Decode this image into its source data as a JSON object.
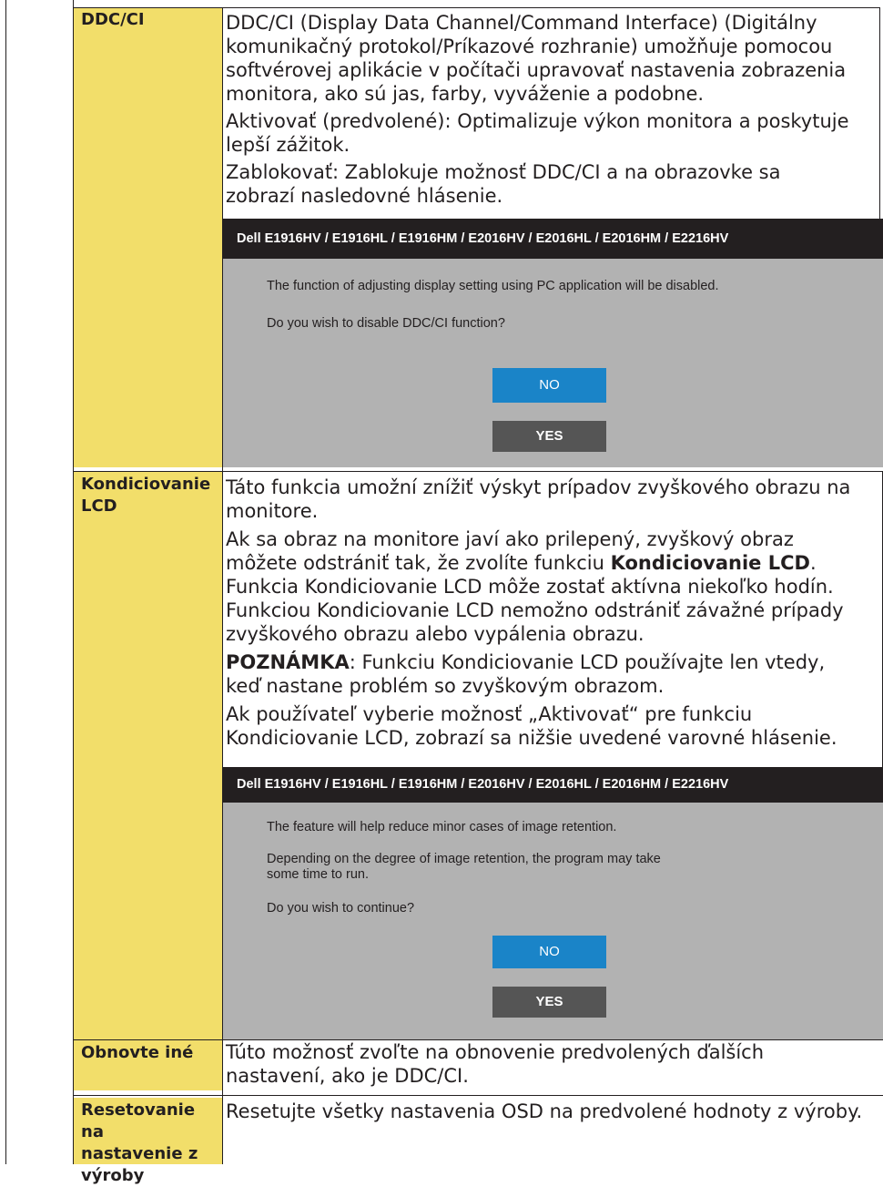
{
  "rows": [
    {
      "name": "DDC/CI",
      "paragraphs": [
        [
          "DDC/CI (Display Data Channel/Command Interface) (Digitálny",
          "komunikačný protokol/Príkazové rozhranie) umožňuje pomocou",
          "softvérovej aplikácie v počítači upravovať nastavenia zobrazenia",
          "monitora, ako sú jas, farby, vyváženie a podobne."
        ],
        [
          "Aktivovať (predvolené): Optimalizuje výkon monitora a poskytuje",
          "lepší zážitok."
        ],
        [
          "Zablokovať: Zablokuje možnosť DDC/CI a na obrazovke sa",
          "zobrazí nasledovné hlásenie."
        ]
      ],
      "dialog": {
        "title": "Dell E1916HV / E1916HL / E1916HM / E2016HV / E2016HL / E2016HM / E2216HV",
        "lines": [
          "The function of adjusting display setting using PC application will be disabled.",
          "Do you wish to disable DDC/CI function?"
        ],
        "no_label": "NO",
        "yes_label": "YES"
      }
    },
    {
      "name_lines": [
        "Kondiciovanie",
        "LCD"
      ],
      "p1": [
        "Táto funkcia umožní znížiť výskyt prípadov zvyškového obrazu na",
        "monitore."
      ],
      "p2_line1": "Ak sa obraz na monitore javí ako prilepený, zvyškový obraz",
      "p2_line2_pre": "môžete odstrániť tak, že zvolíte funkciu ",
      "p2_line2_bold": "Kondiciovanie LCD",
      "p2_line2_post": ".",
      "p2_rest": [
        "Funkcia Kondiciovanie LCD môže zostať aktívna niekoľko hodín.",
        "Funkciou Kondiciovanie LCD nemožno odstrániť závažné prípady",
        "zvyškového obrazu alebo vypálenia obrazu."
      ],
      "note_label": "POZNÁMKA",
      "note_line1": ": Funkciu Kondiciovanie LCD používajte len vtedy,",
      "note_line2": "keď nastane problém so zvyškovým obrazom.",
      "p4": [
        "Ak používateľ vyberie možnosť „Aktivovať“ pre funkciu",
        "Kondiciovanie LCD, zobrazí sa nižšie uvedené varovné hlásenie."
      ],
      "dialog": {
        "title": "Dell E1916HV / E1916HL / E1916HM / E2016HV / E2016HL / E2016HM / E2216HV",
        "line1": "The feature will help reduce minor cases of image retention.",
        "line2a": "Depending on the degree of image retention, the program may take",
        "line2b": "some time to run.",
        "line3": "Do you wish to continue?",
        "no_label": "NO",
        "yes_label": "YES"
      }
    },
    {
      "name": "Obnovte iné",
      "lines": [
        "Túto možnosť zvoľte na obnovenie predvolených ďalších",
        "nastavení, ako je DDC/CI."
      ]
    },
    {
      "name_lines": [
        "Resetovanie na",
        "nastavenie z",
        "výroby"
      ],
      "lines": [
        "Resetujte všetky nastavenia OSD na predvolené hodnoty z výroby."
      ]
    }
  ],
  "colors": {
    "name_cell_bg": "#f2de6a",
    "dialog_bg": "#b2b2b2",
    "dialog_title_bg": "#231f20",
    "no_button": "#1a84c8",
    "yes_button": "#555555"
  }
}
